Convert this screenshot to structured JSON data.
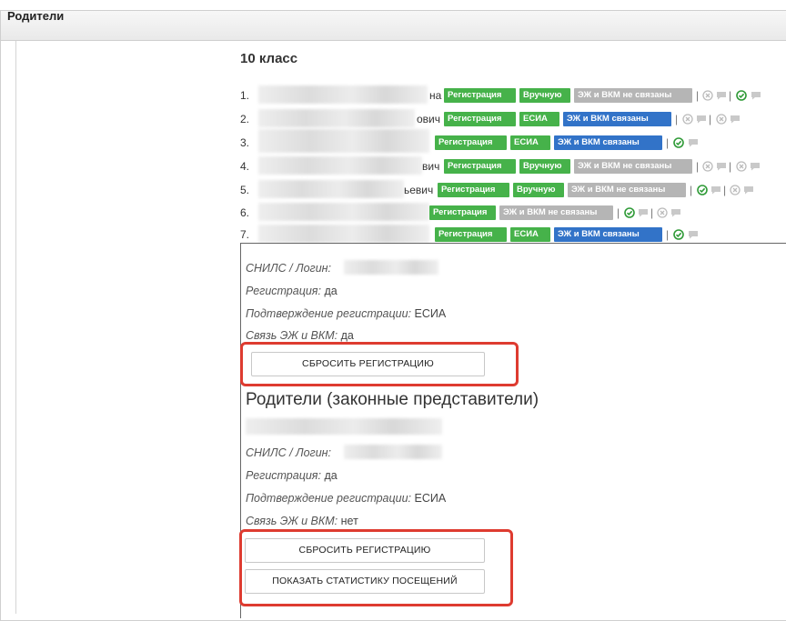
{
  "panel": {
    "title": "Родители"
  },
  "class_title": "10 класс",
  "students": [
    {
      "num": "1.",
      "tail": "на",
      "chips": [
        "Регистрация",
        "Вручную",
        "ЭЖ и ВКМ не связаны"
      ]
    },
    {
      "num": "2.",
      "tail": "ович",
      "chips": [
        "Регистрация",
        "ЕСИА",
        "ЭЖ и ВКМ связаны"
      ]
    },
    {
      "num": "3.",
      "tail": "",
      "chips": [
        "Регистрация",
        "ЕСИА",
        "ЭЖ и ВКМ связаны"
      ]
    },
    {
      "num": "4.",
      "tail": "вич",
      "chips": [
        "Регистрация",
        "Вручную",
        "ЭЖ и ВКМ не связаны"
      ]
    },
    {
      "num": "5.",
      "tail": "ьевич",
      "chips": [
        "Регистрация",
        "Вручную",
        "ЭЖ и ВКМ не связаны"
      ]
    },
    {
      "num": "6.",
      "tail": "",
      "chips": [
        "Регистрация",
        "ЭЖ и ВКМ не связаны"
      ]
    },
    {
      "num": "7.",
      "tail": "",
      "chips": [
        "Регистрация",
        "ЕСИА",
        "ЭЖ и ВКМ связаны"
      ]
    }
  ],
  "separator": "|",
  "student_detail": {
    "snils_label": "СНИЛС / Логин:",
    "reg_label": "Регистрация:",
    "reg_value": "да",
    "confirm_label": "Подтверждение регистрации:",
    "confirm_value": "ЕСИА",
    "link_label": "Связь ЭЖ и ВКМ:",
    "link_value": "да",
    "reset_button": "СБРОСИТЬ РЕГИСТРАЦИЮ"
  },
  "parents_heading": "Родители (законные представители)",
  "parent_detail": {
    "snils_label": "СНИЛС / Логин:",
    "reg_label": "Регистрация:",
    "reg_value": "да",
    "confirm_label": "Подтверждение регистрации:",
    "confirm_value": "ЕСИА",
    "link_label": "Связь ЭЖ и ВКМ:",
    "link_value": "нет",
    "reset_button": "СБРОСИТЬ РЕГИСТРАЦИЮ",
    "stats_button": "ПОКАЗАТЬ СТАТИСТИКУ ПОСЕЩЕНИЙ"
  },
  "colors": {
    "green": "#46b24a",
    "blue": "#3273c8",
    "gray": "#b5b5b5",
    "highlight": "#de3b30"
  },
  "icons": [
    "x-circle-icon",
    "comment-icon",
    "check-circle-icon"
  ]
}
